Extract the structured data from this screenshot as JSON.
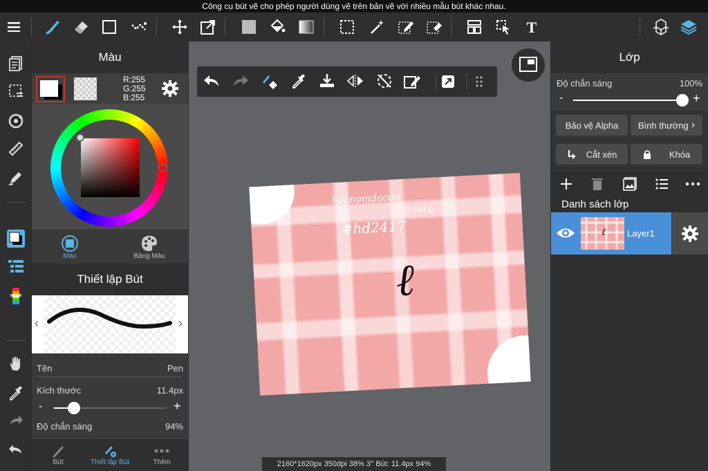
{
  "tooltip": "Công cụ bút vẽ cho phép người dùng vẽ trên bản vẽ với nhiều mẫu bút khác nhau.",
  "color_panel": {
    "title": "Màu",
    "rgb": {
      "r": "R:255",
      "g": "G:255",
      "b": "B:255"
    },
    "tab_color": "Màu",
    "tab_palette": "Bảng Màu"
  },
  "brush_panel": {
    "title": "Thiết lập Bút",
    "name_label": "Tên",
    "name_value": "Pen",
    "size_label": "Kích thước",
    "size_value": "11.4px",
    "size_fraction": 0.18,
    "opacity_label": "Độ chắn sáng",
    "opacity_value": "94%",
    "minus": "-",
    "plus": "+"
  },
  "bottom_tabs": [
    {
      "label": "Bút"
    },
    {
      "label": "Thiết lập Bút"
    },
    {
      "label": "Thêm"
    }
  ],
  "layer_panel": {
    "title": "Lớp",
    "opacity_label": "Độ chắn sáng",
    "opacity_value": "100%",
    "opacity_fraction": 1.0,
    "minus": "-",
    "plus": "+",
    "alpha_protect": "Bảo vệ Alpha",
    "blend_mode": "Bình thường",
    "clip": "Cắt xén",
    "lock": "Khóa",
    "list_title": "Danh sách lớp",
    "layers": [
      {
        "name": "Layer1"
      }
    ]
  },
  "canvas": {
    "handwriting": "hoanomdocdo",
    "handwriting2": "@ vâng",
    "hashtag": "#hd2417",
    "glyph": "ℓ"
  },
  "status_bar": "2160*1620px 350dpi 38% 3° Bút: 11.4px 94%"
}
